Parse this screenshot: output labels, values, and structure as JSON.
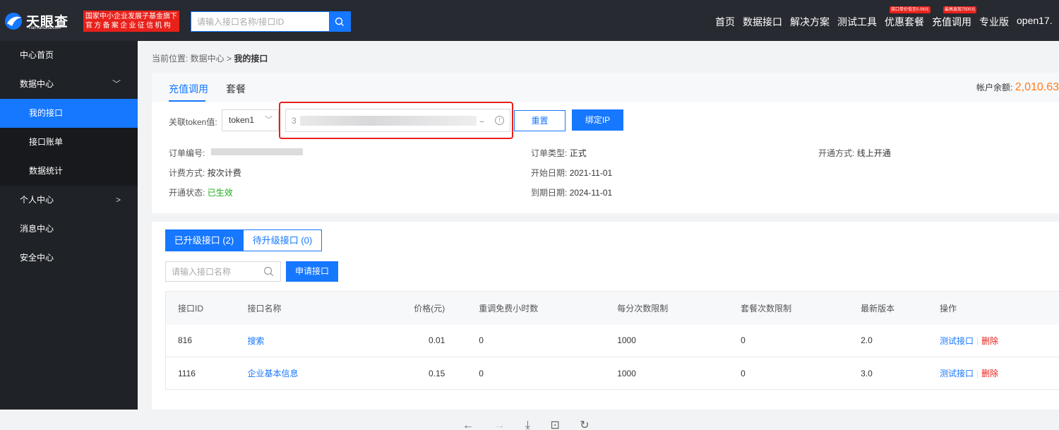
{
  "header": {
    "logo_cn": "天眼查",
    "logo_en": "TianYanCha.com",
    "org_line1": "国家中小企业发展子基金旗下",
    "org_line2": "官方备案企业征信机构",
    "search_placeholder": "请输入接口名称/接口ID",
    "nav": [
      "首页",
      "数据接口",
      "解决方案",
      "测试工具",
      "优惠套餐",
      "充值调用",
      "专业版",
      "open17."
    ],
    "promo1": "接口单价低至0.06元",
    "promo2": "最高返现7500元"
  },
  "sidebar": {
    "items": [
      {
        "label": "中心首页"
      },
      {
        "label": "数据中心"
      },
      {
        "label": "我的接口"
      },
      {
        "label": "接口账单"
      },
      {
        "label": "数据统计"
      },
      {
        "label": "个人中心"
      },
      {
        "label": "消息中心"
      },
      {
        "label": "安全中心"
      }
    ]
  },
  "breadcrumb": {
    "prefix": "当前位置: 数据中心  >",
    "current": "我的接口"
  },
  "account": {
    "tabs": [
      "充值调用",
      "套餐"
    ],
    "balance_label": "帐户余额:",
    "balance_value": "2,010.63",
    "token_label": "关联token值:",
    "token_select": "token1",
    "token_value_start": "3",
    "reset_button": "重置",
    "bind_ip_button": "绑定IP",
    "order_no_label": "订单编号:",
    "order_type_label": "订单类型:",
    "order_type": "正式",
    "open_method_label": "开通方式:",
    "open_method": "线上开通",
    "billing_label": "计费方式:",
    "billing": "按次计费",
    "start_date_label": "开始日期:",
    "start_date": "2021-11-01",
    "status_label": "开通状态:",
    "status": "已生效",
    "end_date_label": "到期日期:",
    "end_date": "2024-11-01"
  },
  "apis": {
    "upgraded_tab": "已升级接口 (2)",
    "pending_tab": "待升级接口 (0)",
    "search_placeholder": "请输入接口名称",
    "apply_button": "申请接口",
    "columns": [
      "接口ID",
      "接口名称",
      "价格(元)",
      "重调免费小时数",
      "每分次数限制",
      "套餐次数限制",
      "最新版本",
      "操作"
    ],
    "rows": [
      {
        "id": "816",
        "name": "搜索",
        "price": "0.01",
        "free_hours": "0",
        "per_min": "1000",
        "package_limit": "0",
        "version": "2.0",
        "test": "测试接口",
        "delete": "删除"
      },
      {
        "id": "1116",
        "name": "企业基本信息",
        "price": "0.15",
        "free_hours": "0",
        "per_min": "1000",
        "package_limit": "0",
        "version": "3.0",
        "test": "测试接口",
        "delete": "删除"
      }
    ]
  }
}
